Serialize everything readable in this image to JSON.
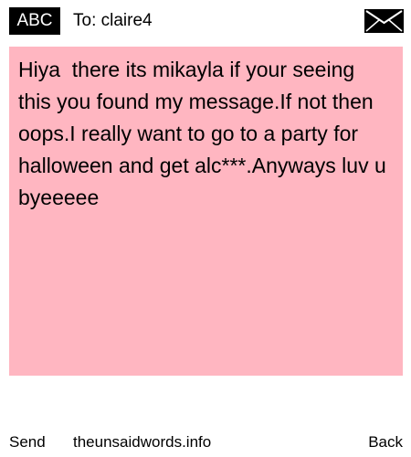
{
  "header": {
    "input_mode": "ABC",
    "recipient": "To: claire4",
    "envelope_icon": "envelope-icon"
  },
  "message": {
    "background": "#ffb6c1",
    "text": "Hiya  there its mikayla if your seeing this you found my message.If not then oops.I really want to go to a party for halloween and get alc***.Anyways luv u byeeeee"
  },
  "footer": {
    "send_label": "Send",
    "site_label": "theunsaidwords.info",
    "back_label": "Back"
  }
}
